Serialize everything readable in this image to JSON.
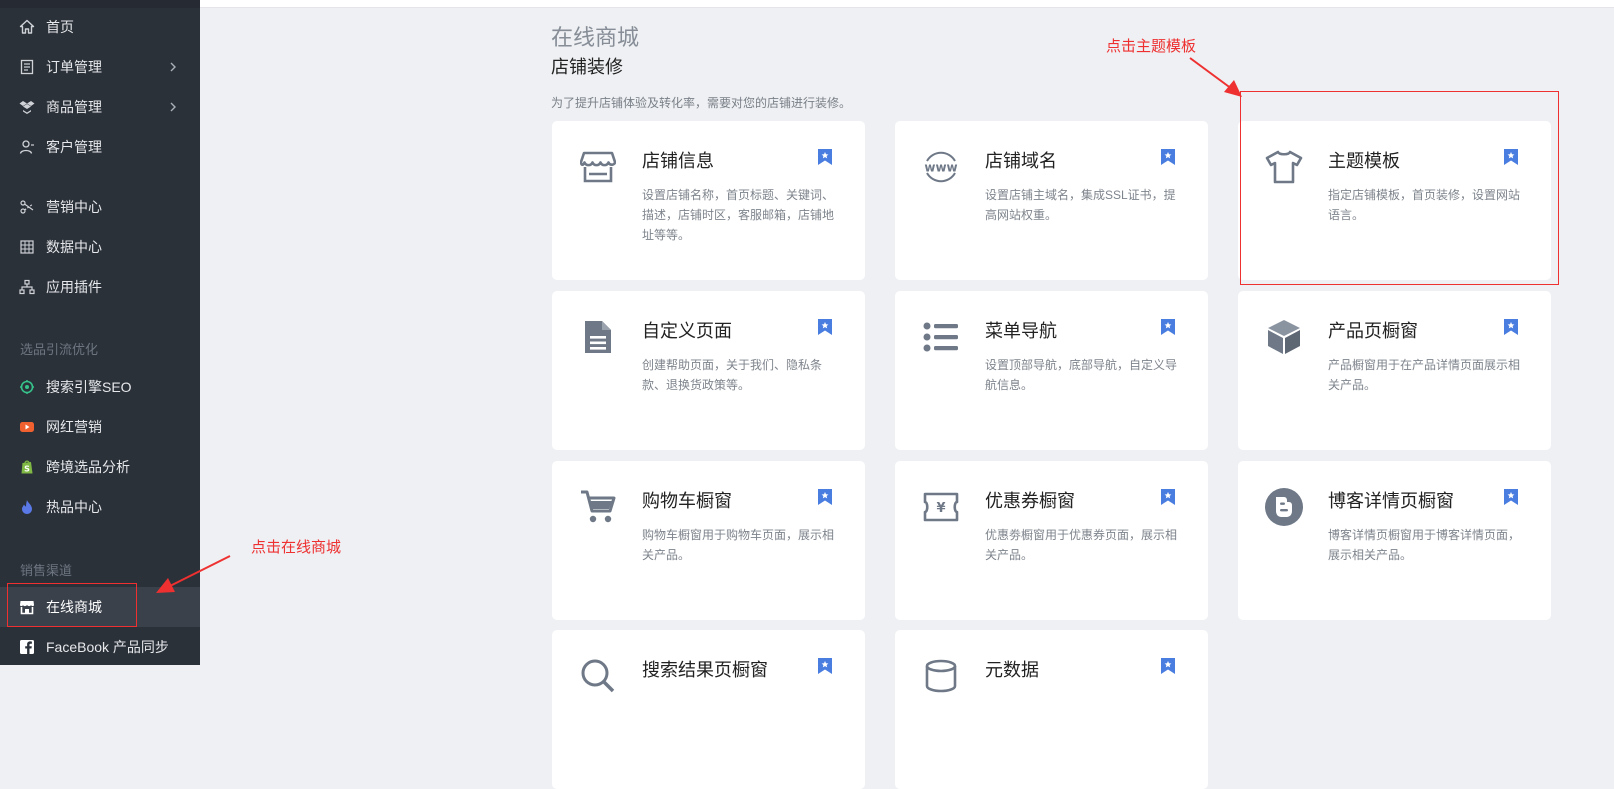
{
  "sidebar": {
    "items": [
      {
        "label": "首页",
        "icon": "home-icon"
      },
      {
        "label": "订单管理",
        "icon": "order-icon",
        "has_submenu": true
      },
      {
        "label": "商品管理",
        "icon": "product-icon",
        "has_submenu": true
      },
      {
        "label": "客户管理",
        "icon": "customer-icon"
      },
      {
        "label": "营销中心",
        "icon": "marketing-icon"
      },
      {
        "label": "数据中心",
        "icon": "data-icon"
      },
      {
        "label": "应用插件",
        "icon": "plugin-icon"
      },
      {
        "label": "搜索引擎SEO",
        "icon": "seo-icon"
      },
      {
        "label": "网红营销",
        "icon": "influencer-icon"
      },
      {
        "label": "跨境选品分析",
        "icon": "shopify-icon"
      },
      {
        "label": "热品中心",
        "icon": "flame-icon"
      },
      {
        "label": "在线商城",
        "icon": "store-icon",
        "active": true
      },
      {
        "label": "FaceBook 产品同步",
        "icon": "facebook-icon"
      }
    ],
    "sections": [
      "选品引流优化",
      "销售渠道"
    ]
  },
  "header": {
    "title": "在线商城",
    "subtitle": "店铺装修",
    "description": "为了提升店铺体验及转化率，需要对您的店铺进行装修。"
  },
  "cards": [
    {
      "title": "店铺信息",
      "desc": "设置店铺名称，首页标题、关键词、描述，店铺时区，客服邮箱，店铺地址等等。",
      "icon": "storefront-icon"
    },
    {
      "title": "店铺域名",
      "desc": "设置店铺主域名，集成SSL证书，提高网站权重。",
      "icon": "www-icon"
    },
    {
      "title": "主题模板",
      "desc": "指定店铺模板，首页装修，设置网站语言。",
      "icon": "tshirt-icon"
    },
    {
      "title": "自定义页面",
      "desc": "创建帮助页面，关于我们、隐私条款、退换货政策等。",
      "icon": "document-icon"
    },
    {
      "title": "菜单导航",
      "desc": "设置顶部导航，底部导航，自定义导航信息。",
      "icon": "list-icon"
    },
    {
      "title": "产品页橱窗",
      "desc": "产品橱窗用于在产品详情页面展示相关产品。",
      "icon": "cube-icon"
    },
    {
      "title": "购物车橱窗",
      "desc": "购物车橱窗用于购物车页面，展示相关产品。",
      "icon": "cart-icon"
    },
    {
      "title": "优惠券橱窗",
      "desc": "优惠劵橱窗用于优惠券页面，展示相关产品。",
      "icon": "coupon-icon"
    },
    {
      "title": "博客详情页橱窗",
      "desc": "博客详情页橱窗用于博客详情页面，展示相关产品。",
      "icon": "blog-icon"
    },
    {
      "title": "搜索结果页橱窗",
      "desc": "",
      "icon": "search-result-icon"
    },
    {
      "title": "元数据",
      "desc": "",
      "icon": "metadata-icon"
    }
  ],
  "annotations": {
    "click_store": "点击在线商城",
    "click_theme": "点击主题模板"
  },
  "colors": {
    "sidebar_bg": "#2b3139",
    "accent_blue": "#4a7de0",
    "annotation_red": "#ee3030",
    "icon_gray": "#6e7887"
  }
}
